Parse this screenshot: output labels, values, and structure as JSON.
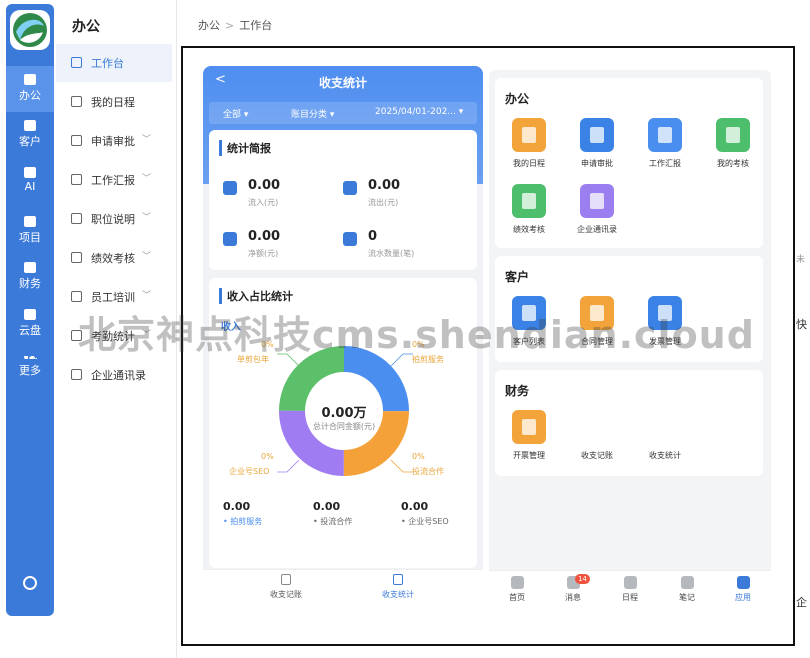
{
  "rail": {
    "items": [
      {
        "label": "办公",
        "icon": "office-icon"
      },
      {
        "label": "客户",
        "icon": "customer-icon"
      },
      {
        "label": "AI",
        "icon": "ai-icon"
      },
      {
        "label": "项目",
        "icon": "project-icon"
      },
      {
        "label": "财务",
        "icon": "finance-icon"
      },
      {
        "label": "云盘",
        "icon": "cloud-disk-icon"
      },
      {
        "label": "更多",
        "icon": "more-icon"
      }
    ]
  },
  "sidebar": {
    "title": "办公",
    "items": [
      {
        "label": "工作台",
        "icon": "dashboard-icon"
      },
      {
        "label": "我的日程",
        "icon": "calendar-icon"
      },
      {
        "label": "申请审批",
        "icon": "approval-icon"
      },
      {
        "label": "工作汇报",
        "icon": "report-icon"
      },
      {
        "label": "职位说明",
        "icon": "position-icon"
      },
      {
        "label": "绩效考核",
        "icon": "performance-icon"
      },
      {
        "label": "员工培训",
        "icon": "training-icon"
      },
      {
        "label": "考勤统计",
        "icon": "attendance-icon"
      },
      {
        "label": "企业通讯录",
        "icon": "contacts-icon"
      }
    ]
  },
  "breadcrumb": {
    "root": "办公",
    "sep": ">",
    "current": "工作台"
  },
  "phone": {
    "title": "收支统计",
    "back": "<",
    "filters": {
      "all": "全部 ▾",
      "category": "账目分类 ▾",
      "date": "2025/04/01-202... ▾"
    },
    "summary": {
      "title": "统计简报",
      "stats": [
        {
          "value": "0.00",
          "label": "流入(元)"
        },
        {
          "value": "0.00",
          "label": "流出(元)"
        },
        {
          "value": "0.00",
          "label": "净额(元)"
        },
        {
          "value": "0",
          "label": "流水数量(笔)"
        }
      ]
    },
    "income": {
      "title": "收入占比统计",
      "tab": "收入",
      "center_value": "0.00万",
      "center_label": "总计合同金额(元)",
      "legend": [
        {
          "pct": "0%",
          "name": "拍剪服务",
          "color": "#4a8ef0"
        },
        {
          "pct": "0%",
          "name": "投流合作",
          "color": "#f5a13a"
        },
        {
          "pct": "0%",
          "name": "企业号SEO",
          "color": "#9f7cf2"
        },
        {
          "pct": "0%",
          "name": "单剪包年",
          "color": "#5cbf6a"
        }
      ],
      "totals": [
        {
          "value": "0.00",
          "label": "• 拍剪服务"
        },
        {
          "value": "0.00",
          "label": "• 投流合作"
        },
        {
          "value": "0.00",
          "label": "• 企业号SEO"
        }
      ]
    },
    "tabs": {
      "a": "收支记账",
      "b": "收支统计"
    }
  },
  "apps": {
    "office": {
      "title": "办公",
      "items": [
        {
          "label": "我的日程",
          "color": "#f2a43a"
        },
        {
          "label": "申请审批",
          "color": "#3b82e6"
        },
        {
          "label": "工作汇报",
          "color": "#4a8ef0"
        },
        {
          "label": "我的考核",
          "color": "#4cbe6c"
        },
        {
          "label": "绩效考核",
          "color": "#4cbe6c"
        },
        {
          "label": "企业通讯录",
          "color": "#9b7ff0"
        }
      ]
    },
    "customer": {
      "title": "客户",
      "items": [
        {
          "label": "客户列表",
          "color": "#3b82e6"
        },
        {
          "label": "合同管理",
          "color": "#f2a43a"
        },
        {
          "label": "发票管理",
          "color": "#3b82e6"
        }
      ]
    },
    "finance": {
      "title": "财务",
      "items": [
        {
          "label": "开票管理",
          "color": "#f2a43a"
        },
        {
          "label": "收支记账",
          "color": ""
        },
        {
          "label": "收支统计",
          "color": ""
        }
      ]
    },
    "tabs": [
      {
        "label": "首页"
      },
      {
        "label": "消息",
        "badge": "14"
      },
      {
        "label": "日程"
      },
      {
        "label": "笔记"
      },
      {
        "label": "应用"
      }
    ]
  },
  "watermark": "北京神点科技cms.shendian.cloud",
  "peek": {
    "a": "未",
    "b": "快",
    "c": "企"
  }
}
